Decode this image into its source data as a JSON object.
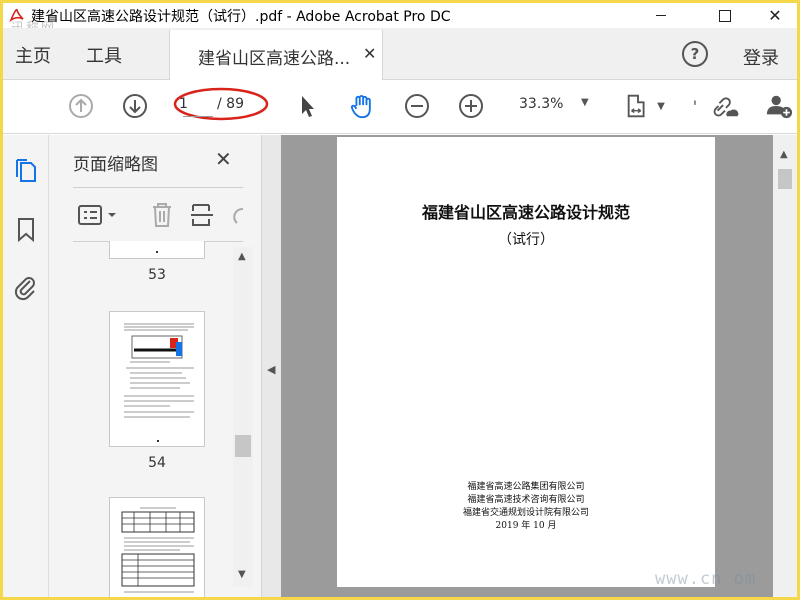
{
  "window": {
    "title": "建省山区高速公路设计规范（试行）.pdf - Adobe Acrobat Pro DC",
    "watermark_top": "迅称网"
  },
  "tabs": {
    "home": "主页",
    "tools": "工具",
    "document": "建省山区高速公路...",
    "login": "登录"
  },
  "toolbar": {
    "current_page": "1",
    "total_pages": "/ 89",
    "zoom": "33.3%",
    "icons": [
      "prev-page-icon",
      "next-page-icon",
      "select-cursor-icon",
      "hand-tool-icon",
      "zoom-out-icon",
      "zoom-in-icon",
      "page-fit-icon",
      "share-link-icon",
      "add-user-icon"
    ]
  },
  "thumbnails": {
    "title": "页面缩略图",
    "pages": [
      {
        "label": "53"
      },
      {
        "label": "54"
      }
    ]
  },
  "document": {
    "title": "福建省山区高速公路设计规范",
    "subtitle": "（试行）",
    "orgs": [
      "福建省高速公路集团有限公司",
      "福建省高速技术咨询有限公司",
      "福建省交通规划设计院有限公司"
    ],
    "date": "2019 年 10 月"
  },
  "watermark_bottom": "www.cn   om",
  "colors": {
    "accent": "#1473e6",
    "frame": "#f4d84a",
    "annotation": "#d9241c"
  }
}
